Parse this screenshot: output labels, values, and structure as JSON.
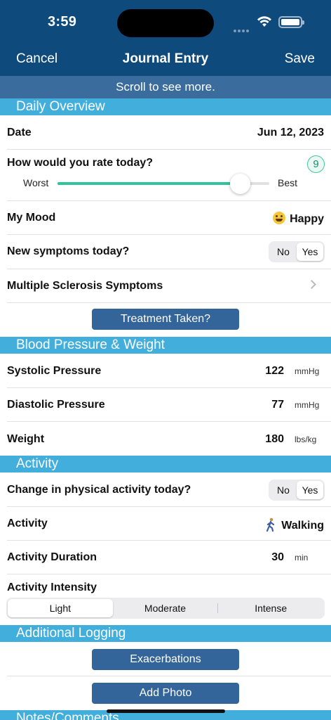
{
  "status": {
    "time": "3:59"
  },
  "nav": {
    "cancel": "Cancel",
    "title": "Journal Entry",
    "save": "Save"
  },
  "scroll_hint": "Scroll to see more.",
  "colors": {
    "nav_bg": "#0f4a7d",
    "hint_bg": "#3a6d9e",
    "section_bg": "#41aedc",
    "button_bg": "#33659a",
    "slider_fill": "#2fc49c"
  },
  "daily": {
    "header": "Daily Overview",
    "date_label": "Date",
    "date_value": "Jun 12, 2023",
    "rate_label": "How would you rate today?",
    "rate_value": "9",
    "rate_fraction": 0.9,
    "rate_min": "Worst",
    "rate_max": "Best",
    "mood_label": "My Mood",
    "mood_value": "Happy",
    "mood_icon": "happy-face-icon",
    "symptoms_label": "New symptoms today?",
    "symptoms_options": [
      "No",
      "Yes"
    ],
    "symptoms_selected": "Yes",
    "ms_label": "Multiple Sclerosis Symptoms",
    "treatment_button": "Treatment Taken?"
  },
  "bp": {
    "header": "Blood Pressure & Weight",
    "systolic_label": "Systolic Pressure",
    "systolic_value": "122",
    "systolic_unit": "mmHg",
    "diastolic_label": "Diastolic Pressure",
    "diastolic_value": "77",
    "diastolic_unit": "mmHg",
    "weight_label": "Weight",
    "weight_value": "180",
    "weight_unit": "lbs/kg"
  },
  "activity": {
    "header": "Activity",
    "change_label": "Change in physical activity today?",
    "change_options": [
      "No",
      "Yes"
    ],
    "change_selected": "Yes",
    "activity_label": "Activity",
    "activity_value": "Walking",
    "activity_icon": "walking-person-icon",
    "duration_label": "Activity Duration",
    "duration_value": "30",
    "duration_unit": "min",
    "intensity_label": "Activity Intensity",
    "intensity_options": [
      "Light",
      "Moderate",
      "Intense"
    ],
    "intensity_selected": "Light"
  },
  "additional": {
    "header": "Additional Logging",
    "exacerbations_button": "Exacerbations",
    "photo_button": "Add Photo"
  },
  "notes": {
    "header": "Notes/Comments"
  }
}
